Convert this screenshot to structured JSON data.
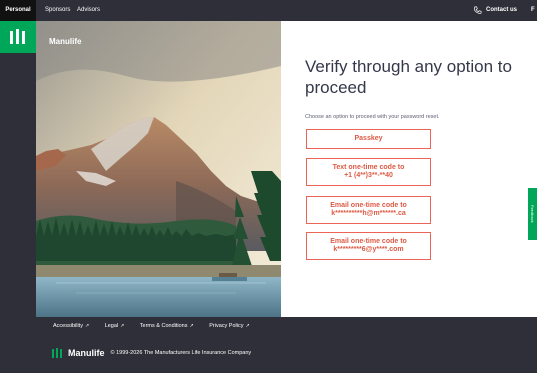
{
  "topnav": {
    "tabs": [
      "Personal",
      "Sponsors",
      "Advisors"
    ],
    "contact_label": "Contact us",
    "truncated": "F"
  },
  "brand": {
    "name": "Manulife"
  },
  "verify": {
    "title": "Verify through any option to proceed",
    "subtitle": "Choose an option to proceed with your password reset.",
    "options": [
      {
        "line1": "Passkey",
        "line2": ""
      },
      {
        "line1": "Text one-time code to",
        "line2": "+1 (4**)3**-**40"
      },
      {
        "line1": "Email one-time code to",
        "line2": "k**********h@m******.ca"
      },
      {
        "line1": "Email one-time code to",
        "line2": "k*********6@y****.com"
      }
    ]
  },
  "feedback_label": "Feedback",
  "footer": {
    "links": [
      "Accessibility",
      "Legal",
      "Terms & Conditions",
      "Privacy Policy"
    ],
    "brand": "Manulife",
    "copyright": "© 1999-2026 The Manufacturers Life Insurance Company"
  },
  "colors": {
    "brand_green": "#00a758",
    "accent_coral": "#ec6453",
    "dark": "#2e2f38"
  }
}
